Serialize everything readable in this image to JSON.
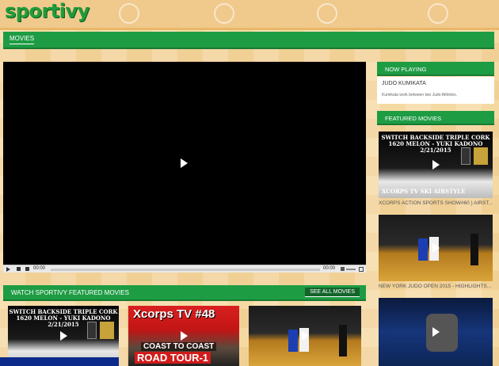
{
  "brand": {
    "logo_text": "sportivy"
  },
  "nav": {
    "tab_label": "MOVIES"
  },
  "player": {
    "time_current": "00:00",
    "time_duration": "00:00"
  },
  "featured_strip": {
    "title": "WATCH SPORTIVY FEATURED MOVIES",
    "see_all_label": "SEE ALL MOVIES",
    "items": [
      {
        "line1": "SWITCH BACKSIDE TRIPLE CORK",
        "line2": "1620 MELON - YUKI KADONO",
        "line3": "2/21/2015"
      },
      {
        "title": "Xcorps TV #48",
        "subtitle": "COAST TO COAST",
        "subtitle2": "ROAD TOUR-1"
      },
      {
        "kind": "judo"
      }
    ]
  },
  "sidebar": {
    "now_playing": {
      "heading": "NOW PLAYING",
      "title": "JUDO KUMIKATA",
      "description": "Kumikata work between two Judo Athletes."
    },
    "featured_movies": {
      "heading": "FEATURED MOVIES",
      "items": [
        {
          "thumb_line1": "SWITCH BACKSIDE TRIPLE CORK",
          "thumb_line2": "1620 MELON - YUKI KADONO",
          "thumb_line3": "2/21/2015",
          "thumb_footer": "XCORPS TV SKI AIRSTYLE",
          "caption": "XCORPS ACTION SPORTS SHOW#60 ) AIRST..."
        },
        {
          "caption": "NEW YORK JUDO OPEN 2015 - HIGHLIGHTS..."
        },
        {
          "caption": ""
        }
      ]
    }
  },
  "colors": {
    "brand_green": "#1e9c44",
    "background": "#f5d9a2"
  }
}
